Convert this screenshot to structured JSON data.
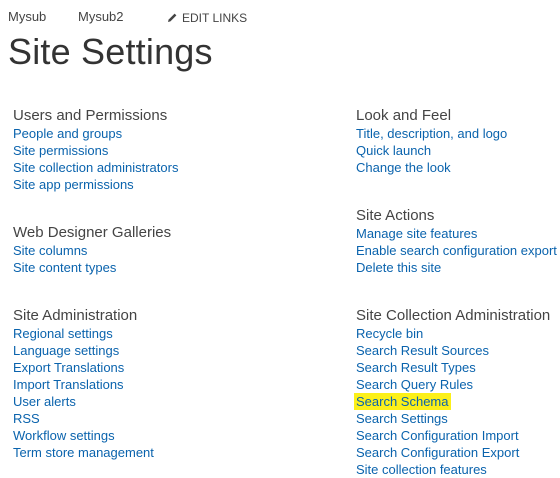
{
  "topnav": {
    "links": [
      "Mysub",
      "Mysub2"
    ],
    "edit_links_label": "EDIT LINKS",
    "edit_icon": "pencil-icon"
  },
  "page_title": "Site Settings",
  "sections": {
    "users_permissions": {
      "title": "Users and Permissions",
      "links": [
        "People and groups",
        "Site permissions",
        "Site collection administrators",
        "Site app permissions"
      ]
    },
    "web_designer_galleries": {
      "title": "Web Designer Galleries",
      "links": [
        "Site columns",
        "Site content types"
      ]
    },
    "site_administration": {
      "title": "Site Administration",
      "links": [
        "Regional settings",
        "Language settings",
        "Export Translations",
        "Import Translations",
        "User alerts",
        "RSS",
        "Workflow settings",
        "Term store management"
      ]
    },
    "look_and_feel": {
      "title": "Look and Feel",
      "links": [
        "Title, description, and logo",
        "Quick launch",
        "Change the look"
      ]
    },
    "site_actions": {
      "title": "Site Actions",
      "links": [
        "Manage site features",
        "Enable search configuration export",
        "Delete this site"
      ]
    },
    "site_collection_administration": {
      "title": "Site Collection Administration",
      "links": [
        "Recycle bin",
        "Search Result Sources",
        "Search Result Types",
        "Search Query Rules",
        "Search Schema",
        "Search Settings",
        "Search Configuration Import",
        "Search Configuration Export",
        "Site collection features"
      ],
      "highlighted_link": "Search Schema"
    }
  },
  "colors": {
    "link": "#0a63ad",
    "heading": "#444444",
    "highlight": "#fcf019"
  }
}
